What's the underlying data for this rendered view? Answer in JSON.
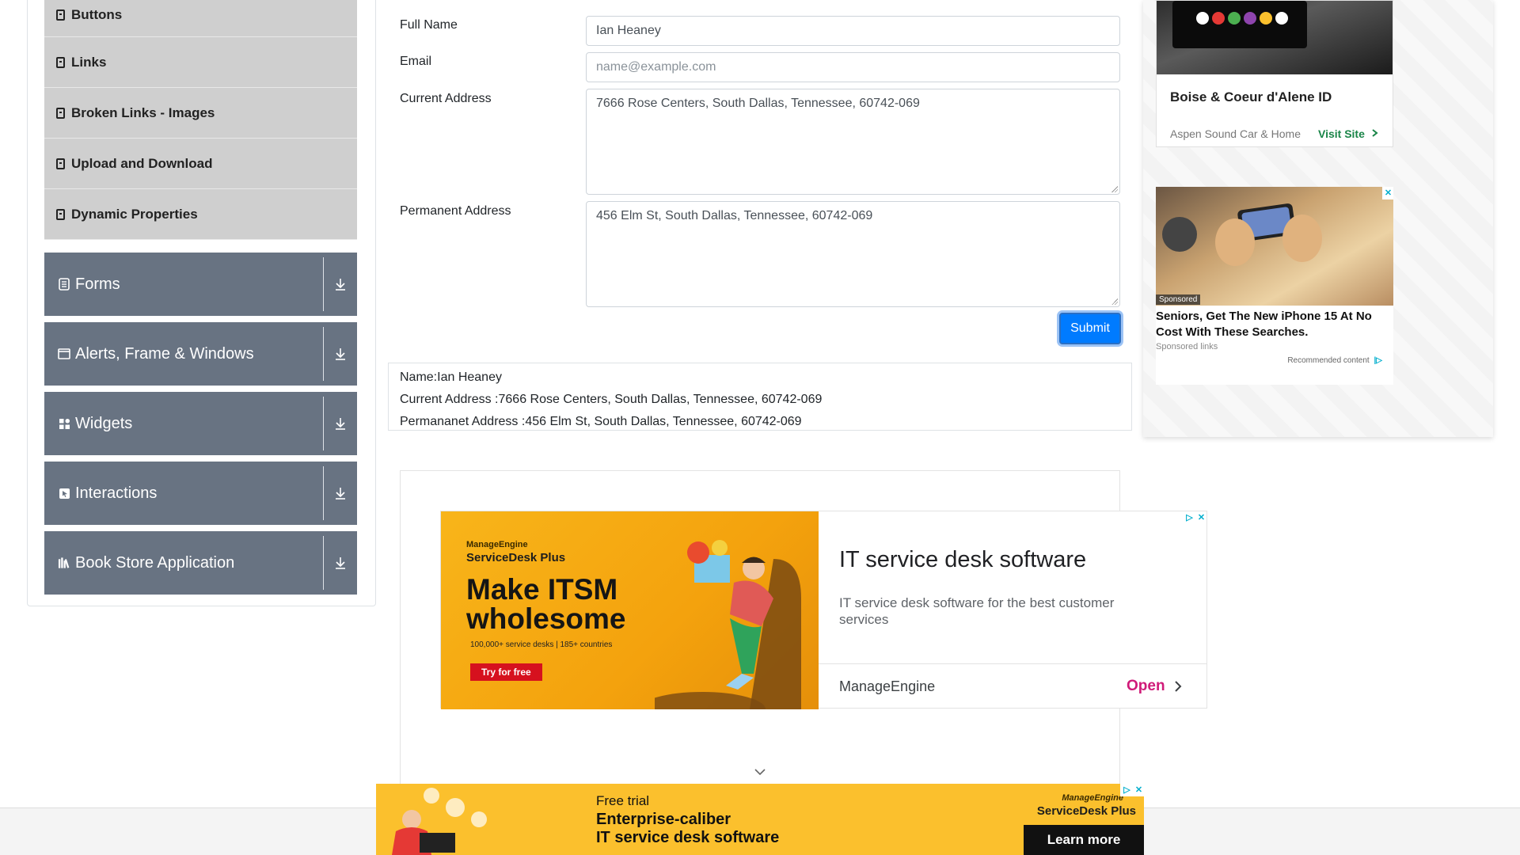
{
  "sidebar": {
    "sub_items": [
      {
        "label": "Buttons"
      },
      {
        "label": "Links"
      },
      {
        "label": "Broken Links - Images"
      },
      {
        "label": "Upload and Download"
      },
      {
        "label": "Dynamic Properties"
      }
    ],
    "groups": [
      {
        "label": "Forms",
        "icon": "document-icon"
      },
      {
        "label": "Alerts, Frame & Windows",
        "icon": "window-icon"
      },
      {
        "label": "Widgets",
        "icon": "grid-icon"
      },
      {
        "label": "Interactions",
        "icon": "pointer-box-icon"
      },
      {
        "label": "Book Store Application",
        "icon": "books-icon"
      }
    ]
  },
  "form": {
    "full_name": {
      "label": "Full Name",
      "value": "Ian Heaney"
    },
    "email": {
      "label": "Email",
      "placeholder": "name@example.com",
      "value": ""
    },
    "current_address": {
      "label": "Current Address",
      "value": "7666 Rose Centers, South Dallas, Tennessee, 60742-069"
    },
    "permanent_address": {
      "label": "Permanent Address",
      "value": "456 Elm St, South Dallas, Tennessee, 60742-069"
    },
    "submit_label": "Submit"
  },
  "output": {
    "name": "Name:Ian Heaney",
    "current_address": "Current Address :7666 Rose Centers, South Dallas, Tennessee, 60742-069",
    "permanent_address": "Permananet Address :456 Elm St, South Dallas, Tennessee, 60742-069"
  },
  "ad_mid": {
    "brand_top": "ManageEngine",
    "brand_product": "ServiceDesk Plus",
    "headline_big": "Make ITSM wholesome",
    "stats": "100,000+ service desks | 185+ countries",
    "cta": "Try for free",
    "title": "IT service desk software",
    "description": "IT service desk software for the best customer services",
    "advertiser": "ManageEngine",
    "open_label": "Open"
  },
  "ad_right": {
    "car_title": "Boise & Coeur d'Alene ID",
    "car_advertiser": "Aspen Sound Car & Home",
    "car_visit": "Visit Site",
    "phone_tag": "Sponsored",
    "phone_title": "Seniors, Get The New iPhone 15 At No Cost With These Searches.",
    "phone_links": "Sponsored links",
    "phone_rec": "Recommended content"
  },
  "ad_bottom": {
    "line1": "Free trial",
    "line2": "Enterprise-caliber",
    "line3": "IT service desk software",
    "brand_top": "ManageEngine",
    "brand_product": "ServiceDesk Plus",
    "cta": "Learn more"
  },
  "colors": {
    "group_bg": "#687382",
    "sub_bg": "#cfcfcf",
    "submit_bg": "#007bff",
    "ad_yellow": "#fbc02d",
    "open_pink": "#d01b79"
  }
}
